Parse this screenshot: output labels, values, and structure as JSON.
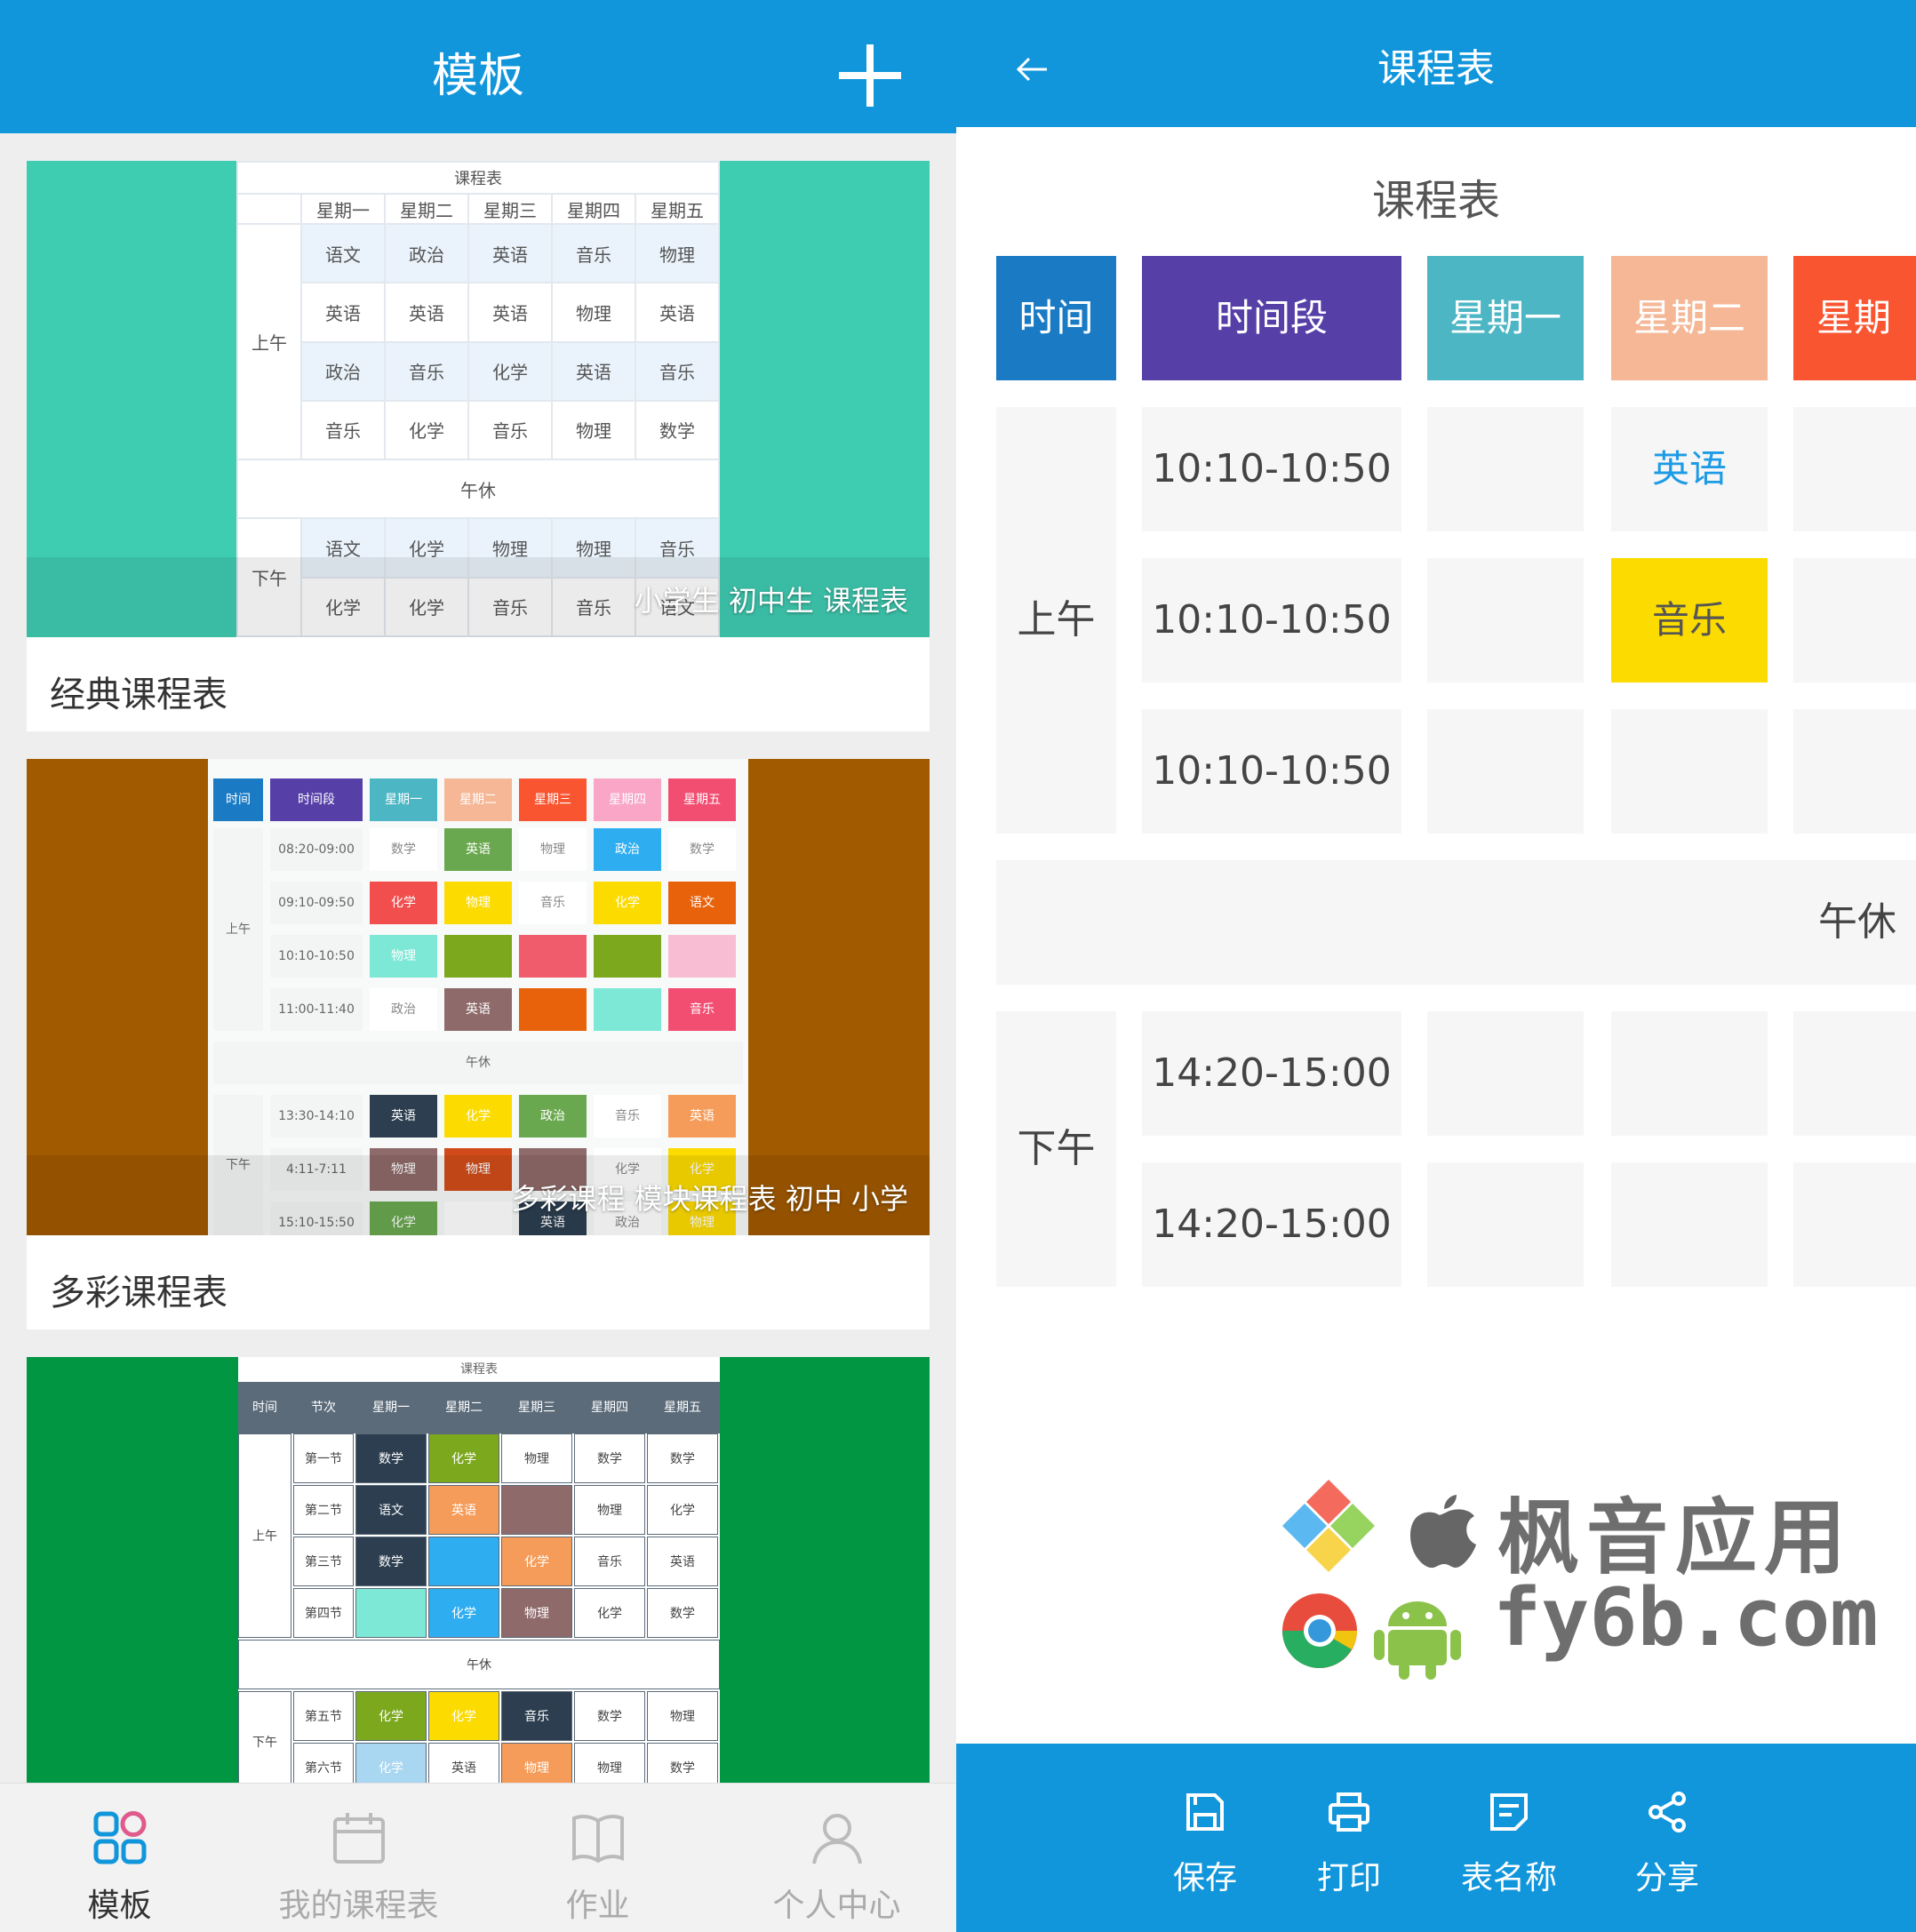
{
  "left": {
    "header": {
      "title": "模板",
      "add_icon": "plus-icon"
    },
    "cards": [
      {
        "tag": "小学生 初中生 课程表",
        "name": "经典课程表",
        "preview": {
          "title": "课程表",
          "days": [
            "星期一",
            "星期二",
            "星期三",
            "星期四",
            "星期五"
          ],
          "morning_label": "上午",
          "afternoon_label": "下午",
          "noon": "午休",
          "morning": [
            [
              "语文",
              "政治",
              "英语",
              "音乐",
              "物理"
            ],
            [
              "英语",
              "英语",
              "英语",
              "物理",
              "英语"
            ],
            [
              "政治",
              "音乐",
              "化学",
              "英语",
              "音乐"
            ],
            [
              "音乐",
              "化学",
              "音乐",
              "物理",
              "数学"
            ]
          ],
          "afternoon": [
            [
              "语文",
              "化学",
              "物理",
              "物理",
              "音乐"
            ],
            [
              "化学",
              "化学",
              "音乐",
              "音乐",
              "语文"
            ]
          ]
        }
      },
      {
        "tag": "多彩课程 模块课程表 初中 小学",
        "name": "多彩课程表",
        "preview": {
          "headers": [
            "时间",
            "时间段",
            "星期一",
            "星期二",
            "星期三",
            "星期四",
            "星期五"
          ],
          "morning_label": "上午",
          "afternoon_label": "下午",
          "noon": "午休",
          "times_morning": [
            "08:20-09:00",
            "09:10-09:50",
            "10:10-10:50",
            "11:00-11:40"
          ],
          "times_afternoon": [
            "13:30-14:10",
            "4:11-7:11",
            "15:10-15:50"
          ],
          "rows": [
            [
              "数学",
              "英语",
              "物理",
              "政治",
              "数学"
            ],
            [
              "化学",
              "物理",
              "音乐",
              "化学",
              "语文"
            ],
            [
              "物理",
              "",
              "",
              "",
              ""
            ],
            [
              "政治",
              "英语",
              "",
              "",
              "音乐"
            ],
            [
              "英语",
              "化学",
              "政治",
              "音乐",
              "英语"
            ],
            [
              "物理",
              "物理",
              "",
              "化学",
              "化学"
            ],
            [
              "化学",
              "",
              "英语",
              "政治",
              "物理"
            ]
          ]
        }
      },
      {
        "tag": "",
        "name": "",
        "preview": {
          "title": "课程表",
          "headers": [
            "时间",
            "节次",
            "星期一",
            "星期二",
            "星期三",
            "星期四",
            "星期五"
          ],
          "morning_label": "上午",
          "afternoon_label": "下午",
          "noon": "午休",
          "periods": [
            "第一节",
            "第二节",
            "第三节",
            "第四节",
            "第五节",
            "第六节"
          ],
          "rows": [
            [
              "数学",
              "化学",
              "物理",
              "数学",
              "数学"
            ],
            [
              "语文",
              "英语",
              "",
              "物理",
              "化学"
            ],
            [
              "数学",
              "",
              "化学",
              "音乐",
              "英语"
            ],
            [
              "",
              "化学",
              "物理",
              "化学",
              "数学"
            ],
            [
              "化学",
              "化学",
              "音乐",
              "数学",
              "物理"
            ],
            [
              "化学",
              "英语",
              "物理",
              "物理",
              "数学"
            ]
          ]
        }
      }
    ],
    "nav": [
      {
        "label": "模板",
        "icon": "grid-icon",
        "active": true
      },
      {
        "label": "我的课程表",
        "icon": "calendar-icon",
        "active": false
      },
      {
        "label": "作业",
        "icon": "book-icon",
        "active": false
      },
      {
        "label": "个人中心",
        "icon": "user-icon",
        "active": false
      }
    ]
  },
  "right": {
    "header": {
      "title": "课程表",
      "back_icon": "arrow-left-icon"
    },
    "sheet_title": "课程表",
    "headers": [
      {
        "label": "时间",
        "color": "#1a7bc4"
      },
      {
        "label": "时间段",
        "color": "#5640a8"
      },
      {
        "label": "星期一",
        "color": "#4db6c4"
      },
      {
        "label": "星期二",
        "color": "#f5b796"
      },
      {
        "label": "星期",
        "color": "#fa5531"
      }
    ],
    "morning_label": "上午",
    "afternoon_label": "下午",
    "noon": "午休",
    "times": [
      "10:10-10:50",
      "10:10-10:50",
      "10:10-10:50",
      "14:20-15:00",
      "14:20-15:00"
    ],
    "classes": {
      "english": {
        "label": "英语",
        "color": "#1e9be6"
      },
      "music": {
        "label": "音乐",
        "bg": "#fcdb00",
        "color": "#555555"
      }
    },
    "toolbar": [
      {
        "label": "保存",
        "icon": "save-icon"
      },
      {
        "label": "打印",
        "icon": "print-icon"
      },
      {
        "label": "表名称",
        "icon": "rename-icon"
      },
      {
        "label": "分享",
        "icon": "share-icon"
      }
    ]
  },
  "watermark": {
    "line1": "枫音应用",
    "line2": "fy6b.com"
  },
  "colors": {
    "brand_blue": "#1296db",
    "card1_bg": "#3fcdb2",
    "card2_bg": "#a15a00",
    "card3_bg": "#009642"
  }
}
